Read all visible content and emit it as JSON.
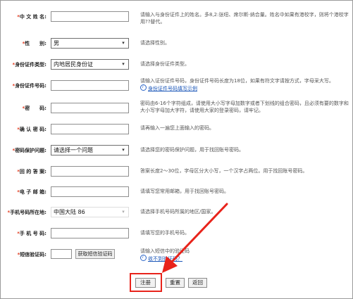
{
  "form": {
    "fields": [
      {
        "label": "中 文 姓 名:",
        "value": "",
        "hint": "请输入与身份证件上的姓名。多8,2:张纽、席尔斯·纳合量。姓名中如果有港校字，则将个港校字用??替代。",
        "type": "text"
      },
      {
        "label": "性　　别:",
        "value": "男",
        "hint": "请选择性别。",
        "type": "select"
      },
      {
        "label": "身份证件类型:",
        "value": "内地居民身份证",
        "hint": "请选择身份证件类型。",
        "type": "select"
      },
      {
        "label": "身份证件号码:",
        "value": "",
        "hint": "请输入证份证件号码，身份证件号码长度为18位，如果有符文字请按方式，字母采大写。",
        "hint_link": "身份证件号码填写示例",
        "type": "text"
      },
      {
        "label": "密　　码:",
        "value": "",
        "hint": "密码由6-16个字符组成，请使用大小写字母加数字或者下划线的组合密码，且必须有要的数字和大小写字母加大字符，请使用大家的登录密码，请牢记。",
        "type": "password"
      },
      {
        "label": "确 认 密 码:",
        "value": "",
        "hint": "请再输入一遍您上面输入的密码。",
        "type": "password"
      },
      {
        "label": "密码保护问题:",
        "value": "请选择一个问题",
        "hint": "请选择您的密码保护问题，用于找回账号密码。",
        "type": "select"
      },
      {
        "label": "回 的 答 案:",
        "value": "",
        "hint": "答案长度2～30位，字母区分大小写，一个汉字占两位。用于找回账号密码。",
        "type": "text"
      },
      {
        "label": "电 子 邮 箱:",
        "value": "",
        "hint": "请填写您常用邮箱，用于找回账号密码。",
        "type": "text"
      },
      {
        "label": "手机号码所在地:",
        "value": "中国大陆 86",
        "hint": "请选择手机号码所属的地区/国家。",
        "type": "select"
      },
      {
        "label": "手 机 号 码:",
        "value": "",
        "hint": "请填写您的手机号码。",
        "type": "text"
      },
      {
        "label": "短信验证码:",
        "value": "",
        "button": "获取短信验证码",
        "hint": "请输入短信中的验证码",
        "hint_link": "收不到验证码？",
        "type": "code"
      }
    ],
    "required_mark": "*",
    "buttons": {
      "register": "注册",
      "reset": "重置",
      "back": "返回"
    }
  },
  "colors": {
    "required": "#e23a1e",
    "highlight": "#e8231b",
    "link": "#1a56b8"
  }
}
